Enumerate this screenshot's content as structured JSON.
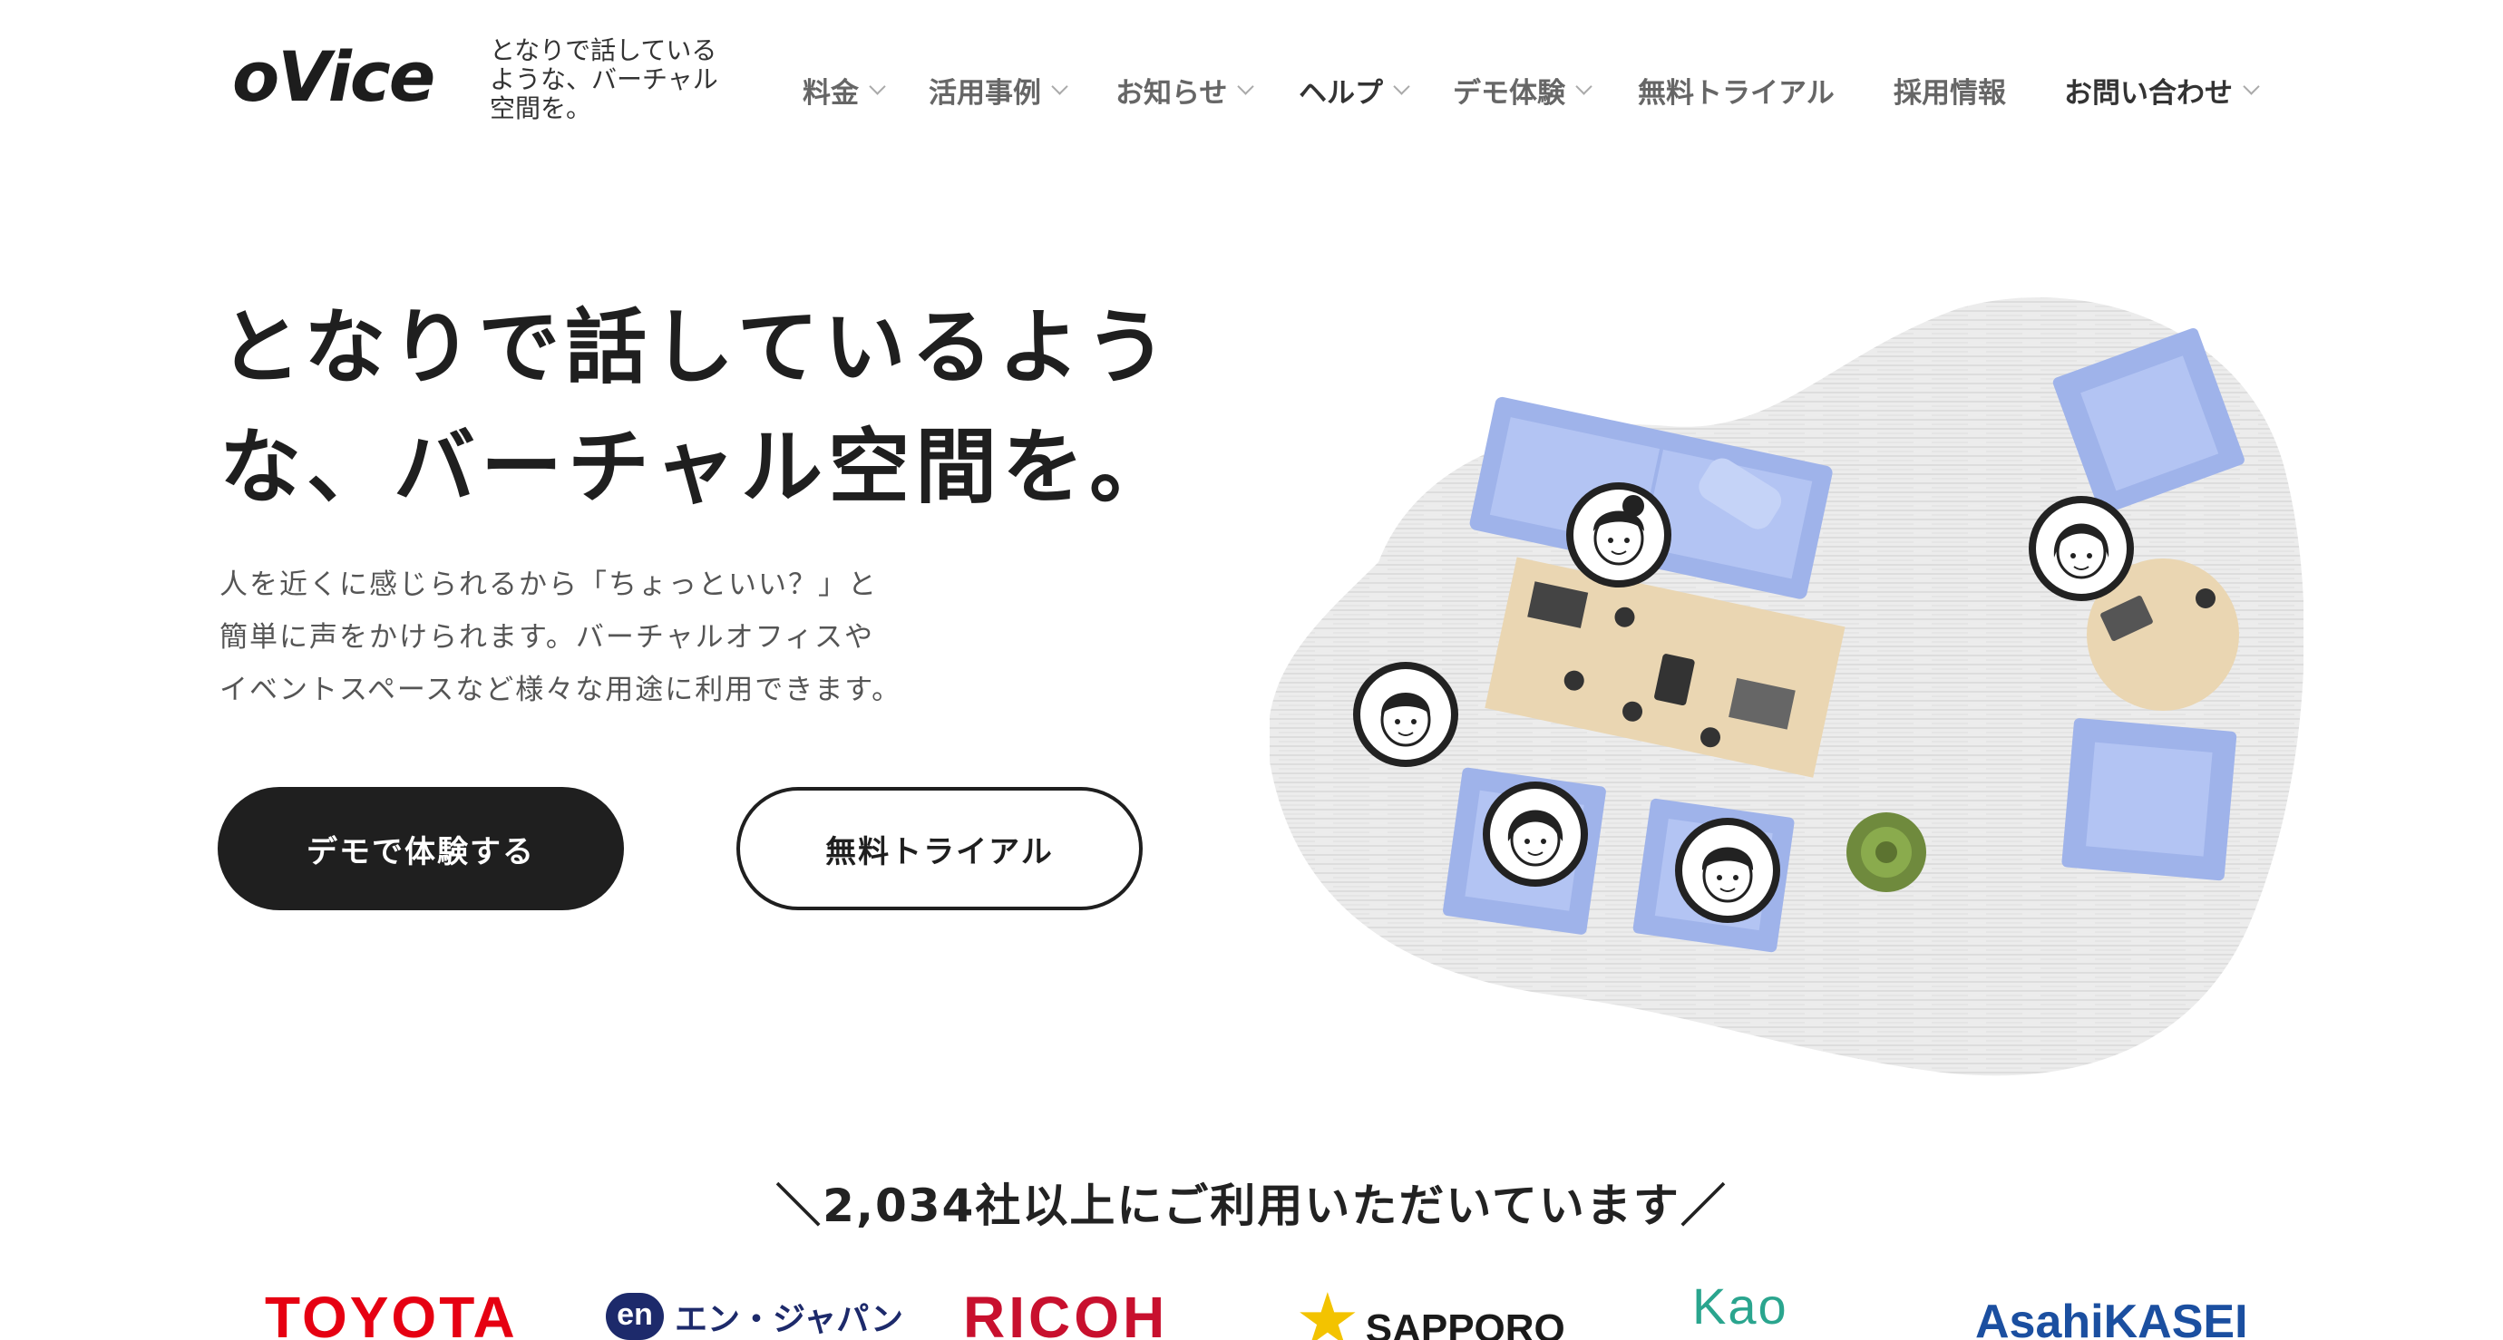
{
  "brand": {
    "logo": "oVice",
    "tagline": "となりで話しているような、バーチャル空間を。"
  },
  "nav": {
    "items": [
      {
        "label": "料金",
        "dropdown": true
      },
      {
        "label": "活用事例",
        "dropdown": true
      },
      {
        "label": "お知らせ",
        "dropdown": true
      },
      {
        "label": "ヘルプ",
        "dropdown": true
      },
      {
        "label": "デモ体験",
        "dropdown": true
      },
      {
        "label": "無料トライアル",
        "dropdown": false
      },
      {
        "label": "採用情報",
        "dropdown": false
      },
      {
        "label": "お問い合わせ",
        "dropdown": true
      }
    ]
  },
  "hero": {
    "title_line1": "となりで話しているよう",
    "title_line2": "な、バーチャル空間を。",
    "desc_line1": "人を近くに感じられるから「ちょっといい？」と",
    "desc_line2": "簡単に声をかけられます。バーチャルオフィスや",
    "desc_line3": "イベントスペースなど様々な用途に利用できます。",
    "btn_demo": "デモで体験する",
    "btn_trial": "無料トライアル"
  },
  "clients": {
    "title": "＼2,034社以上にご利用いただいています／",
    "logos": [
      {
        "name": "TOYOTA",
        "color": "#e60012"
      },
      {
        "name": "エン・ジャパン",
        "color": "#1d2a6b"
      },
      {
        "name": "RICOH",
        "color": "#c8102e"
      },
      {
        "name": "SAPPORO",
        "color": "#1a1a1a"
      },
      {
        "name": "Kao",
        "color": "#2aa58e"
      },
      {
        "name": "AsahiKASEI",
        "color": "#1b4fa0"
      }
    ]
  },
  "colors": {
    "primary_dark": "#1f1f1f",
    "sofa_blue": "#aabcf0",
    "table_wood": "#ead6b2",
    "floor_gray": "#e9e9e9"
  }
}
